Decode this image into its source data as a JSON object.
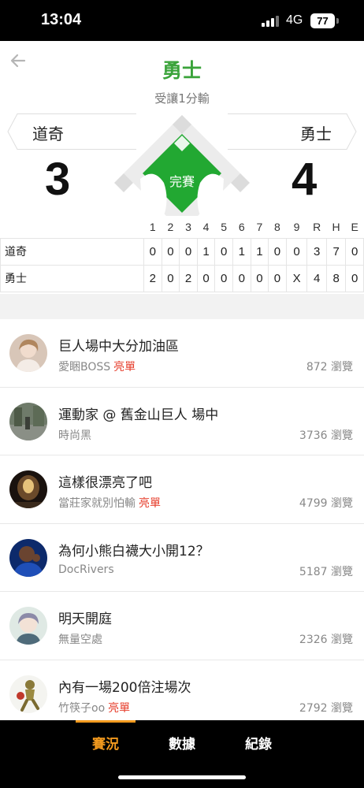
{
  "status_bar": {
    "time": "13:04",
    "network": "4G",
    "battery": "77"
  },
  "header": {
    "title": "勇士",
    "subtitle": "受讓1分輸"
  },
  "game": {
    "away": {
      "name": "道奇",
      "score": "3"
    },
    "home": {
      "name": "勇士",
      "score": "4"
    },
    "status": "完賽"
  },
  "box_score": {
    "headers": [
      "1",
      "2",
      "3",
      "4",
      "5",
      "6",
      "7",
      "8",
      "9",
      "R",
      "H",
      "E"
    ],
    "rows": [
      {
        "team": "道奇",
        "values": [
          "0",
          "0",
          "0",
          "1",
          "0",
          "1",
          "1",
          "0",
          "0",
          "3",
          "7",
          "0"
        ]
      },
      {
        "team": "勇士",
        "values": [
          "2",
          "0",
          "2",
          "0",
          "0",
          "0",
          "0",
          "0",
          "X",
          "4",
          "8",
          "0"
        ]
      }
    ]
  },
  "posts": [
    {
      "title": "巨人場中大分加油區",
      "author": "愛睏BOSS",
      "badge": "亮單",
      "views": "872 瀏覽"
    },
    {
      "title": "運動家 @ 舊金山巨人 場中",
      "author": "時尚黑",
      "badge": "",
      "views": "3736 瀏覽"
    },
    {
      "title": "這樣很漂亮了吧",
      "author": "當莊家就別怕輸",
      "badge": "亮單",
      "views": "4799 瀏覽"
    },
    {
      "title": "為何小熊白襪大小開12？",
      "author": "DocRivers",
      "badge": "",
      "views": "5187 瀏覽"
    },
    {
      "title": "明天開庭",
      "author": "無量空處",
      "badge": "",
      "views": "2326 瀏覽"
    },
    {
      "title": "內有一場200倍注場次",
      "author": "竹筷子oo",
      "badge": "亮單",
      "views": "2792 瀏覽"
    }
  ],
  "bottom_nav": {
    "tabs": [
      "賽況",
      "數據",
      "紀錄"
    ],
    "active": "賽況"
  },
  "colors": {
    "accent_green": "#3aa33a",
    "field_green": "#22a832",
    "badge_red": "#e63c2a",
    "nav_active": "#f39a1e"
  },
  "icons": {
    "back": "arrow-left-icon",
    "signal": "cellular-signal-icon",
    "battery": "battery-icon"
  }
}
